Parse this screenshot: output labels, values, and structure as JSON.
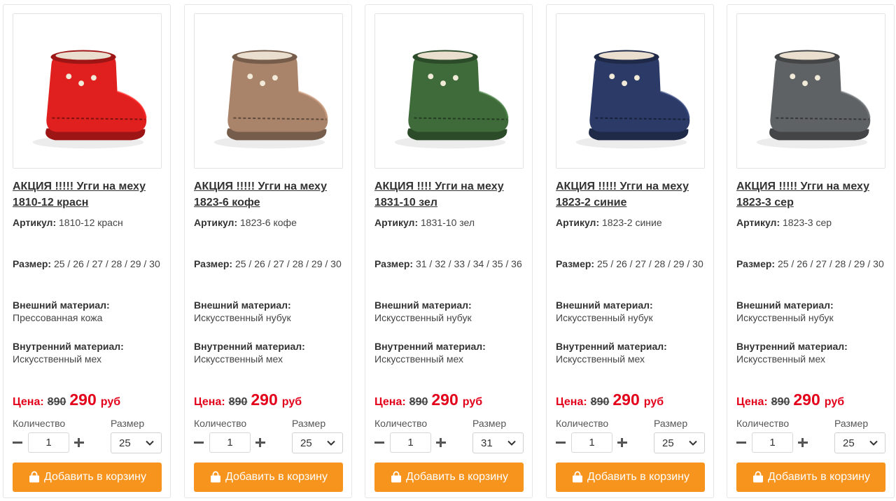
{
  "labels": {
    "sku": "Артикул:",
    "size": "Размер:",
    "outer": "Внешний материал:",
    "inner": "Внутренний материал:",
    "price": "Цена:",
    "quantity": "Количество",
    "size_select": "Размер",
    "add_to_cart": "Добавить в корзину"
  },
  "colors": {
    "accent": "#f7941d",
    "price_red": "#e3001b"
  },
  "icons": {
    "cart": "shopping-bag-icon",
    "minus": "minus-icon",
    "plus": "plus-icon",
    "dropdown": "chevron-down-icon"
  },
  "products": [
    {
      "title": "АКЦИЯ !!!!! Угги на меху 1810-12 красн",
      "sku": "1810-12 красн",
      "sizes": "25 / 26 / 27 / 28 / 29 / 30",
      "outer_material": "Прессованная кожа",
      "inner_material": "Искусственный мех",
      "old_price": "890",
      "new_price": "290",
      "currency": "руб",
      "quantity": "1",
      "selected_size": "25",
      "boot_color": "#e0201e"
    },
    {
      "title": "АКЦИЯ !!!!! Угги на меху 1823-6 кофе",
      "sku": "1823-6 кофе",
      "sizes": "25 / 26 / 27 / 28 / 29 / 30",
      "outer_material": "Искусственный нубук",
      "inner_material": "Искусственный мех",
      "old_price": "890",
      "new_price": "290",
      "currency": "руб",
      "quantity": "1",
      "selected_size": "25",
      "boot_color": "#a9836a"
    },
    {
      "title": "АКЦИЯ !!!! Угги на меху 1831-10 зел",
      "sku": "1831-10 зел",
      "sizes": "31 / 32 / 33 / 34 / 35 / 36",
      "outer_material": "Искусственный нубук",
      "inner_material": "Искусственный мех",
      "old_price": "890",
      "new_price": "290",
      "currency": "руб",
      "quantity": "1",
      "selected_size": "31",
      "boot_color": "#3f6b3a"
    },
    {
      "title": "АКЦИЯ !!!!! Угги на меху 1823-2 синие",
      "sku": "1823-2 синие",
      "sizes": "25 / 26 / 27 / 28 / 29 / 30",
      "outer_material": "Искусственный нубук",
      "inner_material": "Искусственный мех",
      "old_price": "890",
      "new_price": "290",
      "currency": "руб",
      "quantity": "1",
      "selected_size": "25",
      "boot_color": "#2c3a67"
    },
    {
      "title": "АКЦИЯ !!!!! Угги на меху 1823-3 сер",
      "sku": "1823-3 сер",
      "sizes": "25 / 26 / 27 / 28 / 29 / 30",
      "outer_material": "Искусственный нубук",
      "inner_material": "Искусственный мех",
      "old_price": "890",
      "new_price": "290",
      "currency": "руб",
      "quantity": "1",
      "selected_size": "25",
      "boot_color": "#5f6264"
    }
  ]
}
